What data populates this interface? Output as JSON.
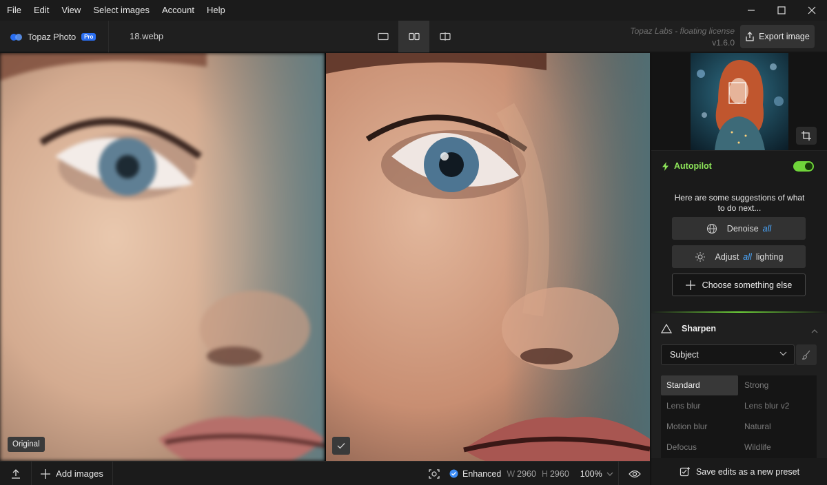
{
  "menu": {
    "items": [
      "File",
      "Edit",
      "View",
      "Select images",
      "Account",
      "Help"
    ]
  },
  "header": {
    "brand_name": "Topaz Photo",
    "badge": "Pro",
    "file_name": "18.webp",
    "license": "Topaz Labs - floating license",
    "version": "v1.6.0",
    "export_label": "Export image"
  },
  "canvas": {
    "original_label": "Original"
  },
  "bottombar": {
    "add_images": "Add images",
    "status": "Enhanced",
    "width_label": "W",
    "width_value": "2960",
    "height_label": "H",
    "height_value": "2960",
    "zoom": "100%"
  },
  "autopilot": {
    "title": "Autopilot",
    "enabled": true,
    "suggest_text": "Here are some suggestions of what to do next...",
    "denoise_label": "Denoise",
    "denoise_scope": "all",
    "adjust_label": "Adjust",
    "adjust_scope": "all",
    "adjust_suffix": "lighting",
    "choose_label": "Choose something else"
  },
  "sharpen": {
    "title": "Sharpen",
    "subject_value": "Subject",
    "models": [
      "Standard",
      "Strong",
      "Lens blur",
      "Lens blur v2",
      "Motion blur",
      "Natural",
      "Defocus",
      "Wildlife"
    ],
    "active_model": "Standard"
  },
  "footer": {
    "save_preset": "Save edits as a new preset"
  },
  "colors": {
    "accent_green": "#6fd43a",
    "accent_blue": "#2a6ef0",
    "scope_blue": "#4ba8ff"
  }
}
